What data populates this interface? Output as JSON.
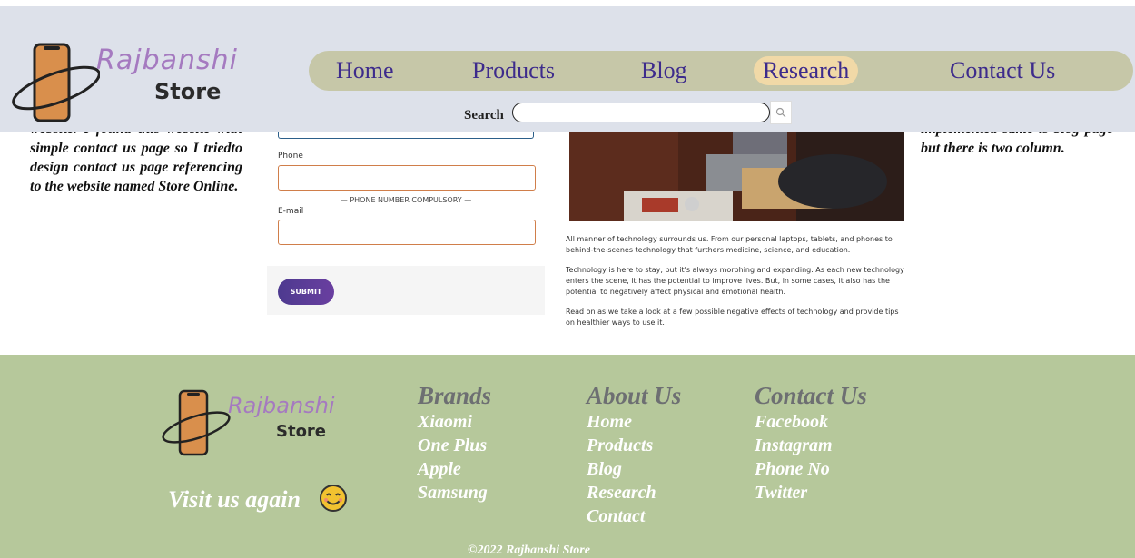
{
  "header": {
    "logo": {
      "line1": "Rajbanshi",
      "line2": "Store"
    },
    "nav": [
      {
        "label": "Home"
      },
      {
        "label": "Products"
      },
      {
        "label": "Blog"
      },
      {
        "label": "Research"
      },
      {
        "label": "Contact Us"
      }
    ],
    "active_nav": "Research",
    "search": {
      "label": "Search",
      "value": ""
    }
  },
  "main": {
    "left_text": "website. I found this website with simple contact us page so I triedto design contact us page referencing to the website named Store Online.",
    "right_text": "implemented same is blog page but there is two column.",
    "form": {
      "phone_label": "Phone",
      "phone_note": "— PHONE NUMBER COMPULSORY —",
      "email_label": "E-mail",
      "submit_label": "SUBMIT"
    },
    "article": [
      "All manner of technology surrounds us. From our personal laptops, tablets, and phones to behind-the-scenes technology that furthers medicine, science, and education.",
      "Technology is here to stay, but it's always morphing and expanding. As each new technology enters the scene, it has the potential to improve lives. But, in some cases, it also has the potential to negatively affect physical and emotional health.",
      "Read on as we take a look at a few possible negative effects of technology and provide tips on healthier ways to use it."
    ]
  },
  "footer": {
    "logo": {
      "line1": "Rajbanshi",
      "line2": "Store"
    },
    "visit_text": "Visit us again",
    "columns": [
      {
        "title": "Brands",
        "links": [
          "Xiaomi",
          "One Plus",
          "Apple",
          "Samsung"
        ]
      },
      {
        "title": "About Us",
        "links": [
          "Home",
          "Products",
          "Blog",
          "Research",
          "Contact"
        ]
      },
      {
        "title": "Contact Us",
        "links": [
          "Facebook",
          "Instagram",
          "Phone No",
          "Twitter"
        ]
      }
    ],
    "copyright": "©2022 Rajbanshi Store"
  },
  "colors": {
    "header_bg": "#dde1ea",
    "nav_bg": "#c6c7a8",
    "nav_text": "#3d2b8c",
    "nav_active_bg": "#f1d9a7",
    "footer_bg": "#b6c89b",
    "submit_bg": "#5a3c97"
  }
}
